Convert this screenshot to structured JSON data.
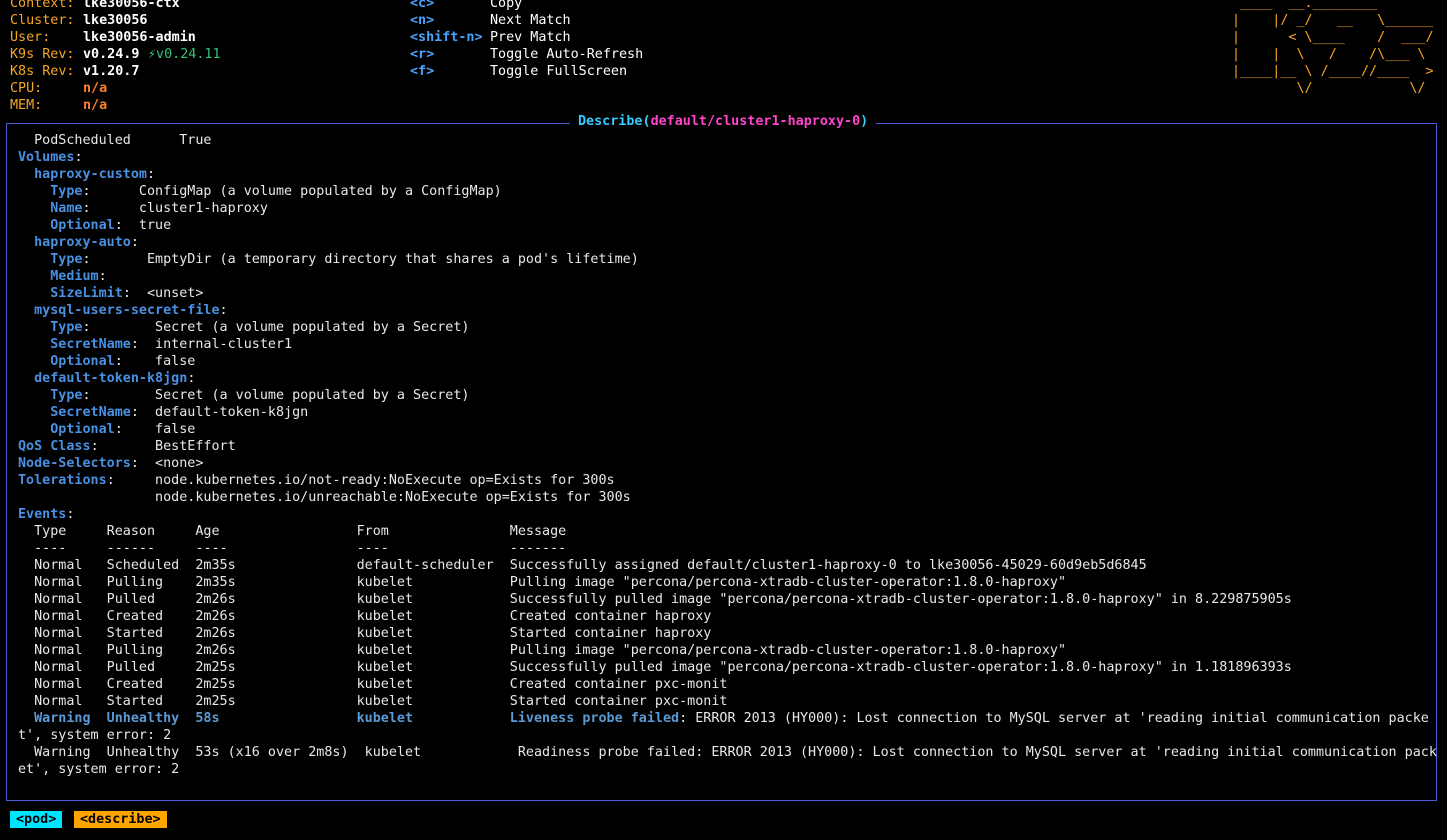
{
  "header": {
    "info": [
      {
        "label": "Context:",
        "value": "lke30056-ctx"
      },
      {
        "label": "Cluster:",
        "value": "lke30056"
      },
      {
        "label": "User:",
        "value": "lke30056-admin"
      },
      {
        "label": "K9s Rev:",
        "value": "v0.24.9",
        "extra": "⚡v0.24.11"
      },
      {
        "label": "K8s Rev:",
        "value": "v1.20.7"
      },
      {
        "label": "CPU:",
        "value": "n/a"
      },
      {
        "label": "MEM:",
        "value": "n/a"
      }
    ],
    "hotkeys": [
      {
        "key": "<c>",
        "desc": "Copy"
      },
      {
        "key": "<n>",
        "desc": "Next Match"
      },
      {
        "key": "<shift-n>",
        "desc": "Prev Match"
      },
      {
        "key": "<r>",
        "desc": "Toggle Auto-Refresh"
      },
      {
        "key": "<f>",
        "desc": "Toggle FullScreen"
      }
    ],
    "logo": " ____  __.________       \n|    |/ _/   __   \\______\n|      < \\____    /  ___/\n|    |  \\   /    /\\___ \\ \n|____|__ \\ /____//____  >\n        \\/            \\/ "
  },
  "describe": {
    "title_prefix": "Describe(",
    "title_path": "default/cluster1-haproxy-0",
    "title_suffix": ")",
    "lines": [
      [
        [
          "plain",
          "  PodScheduled      True"
        ]
      ],
      [
        [
          "blue",
          "Volumes"
        ],
        [
          "plain",
          ":"
        ]
      ],
      [
        [
          "blue",
          "  haproxy-custom"
        ],
        [
          "plain",
          ":"
        ]
      ],
      [
        [
          "blue",
          "    Type"
        ],
        [
          "plain",
          ":      ConfigMap (a volume populated by a ConfigMap)"
        ]
      ],
      [
        [
          "blue",
          "    Name"
        ],
        [
          "plain",
          ":      cluster1-haproxy"
        ]
      ],
      [
        [
          "blue",
          "    Optional"
        ],
        [
          "plain",
          ":  true"
        ]
      ],
      [
        [
          "blue",
          "  haproxy-auto"
        ],
        [
          "plain",
          ":"
        ]
      ],
      [
        [
          "blue",
          "    Type"
        ],
        [
          "plain",
          ":       EmptyDir (a temporary directory that shares a pod's lifetime)"
        ]
      ],
      [
        [
          "blue",
          "    Medium"
        ],
        [
          "plain",
          ":"
        ]
      ],
      [
        [
          "blue",
          "    SizeLimit"
        ],
        [
          "plain",
          ":  <unset>"
        ]
      ],
      [
        [
          "blue",
          "  mysql-users-secret-file"
        ],
        [
          "plain",
          ":"
        ]
      ],
      [
        [
          "blue",
          "    Type"
        ],
        [
          "plain",
          ":        Secret (a volume populated by a Secret)"
        ]
      ],
      [
        [
          "blue",
          "    SecretName"
        ],
        [
          "plain",
          ":  internal-cluster1"
        ]
      ],
      [
        [
          "blue",
          "    Optional"
        ],
        [
          "plain",
          ":    false"
        ]
      ],
      [
        [
          "blue",
          "  default-token-k8jgn"
        ],
        [
          "plain",
          ":"
        ]
      ],
      [
        [
          "blue",
          "    Type"
        ],
        [
          "plain",
          ":        Secret (a volume populated by a Secret)"
        ]
      ],
      [
        [
          "blue",
          "    SecretName"
        ],
        [
          "plain",
          ":  default-token-k8jgn"
        ]
      ],
      [
        [
          "blue",
          "    Optional"
        ],
        [
          "plain",
          ":    false"
        ]
      ],
      [
        [
          "blue",
          "QoS Class"
        ],
        [
          "plain",
          ":       BestEffort"
        ]
      ],
      [
        [
          "blue",
          "Node-Selectors"
        ],
        [
          "plain",
          ":  <none>"
        ]
      ],
      [
        [
          "blue",
          "Tolerations"
        ],
        [
          "plain",
          ":     node.kubernetes.io/not-ready:NoExecute op=Exists for 300s"
        ]
      ],
      [
        [
          "plain",
          "                 node.kubernetes.io/unreachable:NoExecute op=Exists for 300s"
        ]
      ],
      [
        [
          "blue",
          "Events"
        ],
        [
          "plain",
          ":"
        ]
      ],
      [
        [
          "plain",
          "  Type     Reason     Age                 From               Message"
        ]
      ],
      [
        [
          "plain",
          "  ----     ------     ----                ----               -------"
        ]
      ],
      [
        [
          "plain",
          "  Normal   Scheduled  2m35s               default-scheduler  Successfully assigned default/cluster1-haproxy-0 to lke30056-45029-60d9eb5d6845"
        ]
      ],
      [
        [
          "plain",
          "  Normal   Pulling    2m35s               kubelet            Pulling image \"percona/percona-xtradb-cluster-operator:1.8.0-haproxy\""
        ]
      ],
      [
        [
          "plain",
          "  Normal   Pulled     2m26s               kubelet            Successfully pulled image \"percona/percona-xtradb-cluster-operator:1.8.0-haproxy\" in 8.229875905s"
        ]
      ],
      [
        [
          "plain",
          "  Normal   Created    2m26s               kubelet            Created container haproxy"
        ]
      ],
      [
        [
          "plain",
          "  Normal   Started    2m26s               kubelet            Started container haproxy"
        ]
      ],
      [
        [
          "plain",
          "  Normal   Pulling    2m26s               kubelet            Pulling image \"percona/percona-xtradb-cluster-operator:1.8.0-haproxy\""
        ]
      ],
      [
        [
          "plain",
          "  Normal   Pulled     2m25s               kubelet            Successfully pulled image \"percona/percona-xtradb-cluster-operator:1.8.0-haproxy\" in 1.181896393s"
        ]
      ],
      [
        [
          "plain",
          "  Normal   Created    2m25s               kubelet            Created container pxc-monit"
        ]
      ],
      [
        [
          "plain",
          "  Normal   Started    2m25s               kubelet            Started container pxc-monit"
        ]
      ],
      [
        [
          "wblue",
          "  Warning  Unhealthy  58s                 kubelet            Liveness probe failed"
        ],
        [
          "plain",
          ": ERROR 2013 (HY000): Lost connection to MySQL server at 'reading initial communication packe"
        ]
      ],
      [
        [
          "plain",
          "t', system error: 2"
        ]
      ],
      [
        [
          "plain",
          "  Warning  Unhealthy  53s (x16 over 2m8s)  kubelet            Readiness probe failed: ERROR 2013 (HY000): Lost connection to MySQL server at 'reading initial communication pack"
        ]
      ],
      [
        [
          "plain",
          "et', system error: 2"
        ]
      ]
    ]
  },
  "breadcrumbs": [
    {
      "label": "<pod>",
      "color": "#00e5ff"
    },
    {
      "label": "<describe>",
      "color": "#ffa500"
    }
  ]
}
